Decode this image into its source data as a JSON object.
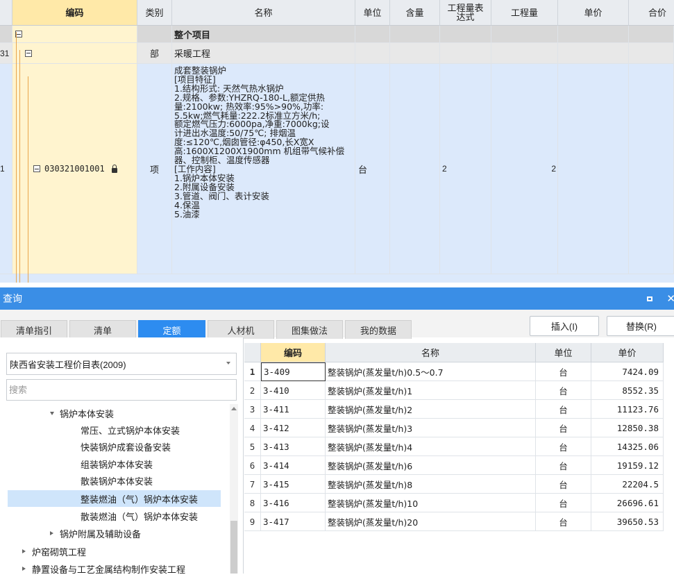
{
  "grid": {
    "headers": {
      "code": "编码",
      "category": "类别",
      "name": "名称",
      "unit": "单位",
      "content": "含量",
      "qty_expr_line1": "工程量表",
      "qty_expr_line2": "达式",
      "quantity": "工程量",
      "unit_price": "单价",
      "total": "合价"
    },
    "rows": {
      "project": {
        "index": "",
        "name": "整个项目"
      },
      "part": {
        "index": "31",
        "category": "部",
        "name": "采暖工程"
      },
      "item": {
        "index": "1",
        "code": "030321001001",
        "category": "项",
        "unit": "台",
        "qty_expr": "2",
        "quantity": "2",
        "desc_lines": [
          "成套整装锅炉",
          "[项目特征]",
          "1.结构形式: 天然气热水锅炉",
          "2.规格、参数:YHZRQ-180-L,额定供热",
          "量:2100kw; 热效率:95%>90%,功率:",
          "5.5kw;燃气耗量:222.2标准立方米/h;",
          "额定燃气压力:6000pa,净重:7000kg;设",
          "计进出水温度:50/75℃; 排烟温",
          "度:≤120℃,烟囱管径:φ450,长X宽X",
          "高:1600X1200X1900mm 机组带气候补偿",
          "器、控制柜、温度传感器",
          "[工作内容]",
          "1.锅炉本体安装",
          "2.附属设备安装",
          "3.管道、阀门、表计安装",
          "4.保温",
          "5.油漆"
        ]
      }
    }
  },
  "query": {
    "title": "查询",
    "tabs": [
      "清单指引",
      "清单",
      "定额",
      "人材机",
      "图集做法",
      "我的数据"
    ],
    "active_tab": "定额",
    "insert_button": "插入(I)",
    "replace_button": "替换(R)",
    "library_select": "陕西省安装工程价目表(2009)",
    "search_placeholder": "搜索",
    "tree": [
      {
        "label": "锅炉本体安装",
        "level": 1,
        "expanded": true
      },
      {
        "label": "常压、立式锅炉本体安装",
        "level": 2
      },
      {
        "label": "快装锅炉成套设备安装",
        "level": 2
      },
      {
        "label": "组装锅炉本体安装",
        "level": 2
      },
      {
        "label": "散装锅炉本体安装",
        "level": 2
      },
      {
        "label": "整装燃油（气）锅炉本体安装",
        "level": 2,
        "selected": true
      },
      {
        "label": "散装燃油（气）锅炉本体安装",
        "level": 2
      },
      {
        "label": "锅炉附属及辅助设备",
        "level": 1,
        "expanded": false
      },
      {
        "label": "炉窑砌筑工程",
        "level": 0,
        "expanded": false
      },
      {
        "label": "静置设备与工艺金属结构制作安装工程",
        "level": 0,
        "expanded": false
      }
    ],
    "table": {
      "headers": {
        "code": "编码",
        "name": "名称",
        "unit": "单位",
        "price": "单价"
      },
      "rows": [
        {
          "idx": "1",
          "code": "3-409",
          "name": "整装锅炉(蒸发量t/h)0.5～0.7",
          "unit": "台",
          "price": "7424.09"
        },
        {
          "idx": "2",
          "code": "3-410",
          "name": "整装锅炉(蒸发量t/h)1",
          "unit": "台",
          "price": "8552.35"
        },
        {
          "idx": "3",
          "code": "3-411",
          "name": "整装锅炉(蒸发量t/h)2",
          "unit": "台",
          "price": "11123.76"
        },
        {
          "idx": "4",
          "code": "3-412",
          "name": "整装锅炉(蒸发量t/h)3",
          "unit": "台",
          "price": "12850.38"
        },
        {
          "idx": "5",
          "code": "3-413",
          "name": "整装锅炉(蒸发量t/h)4",
          "unit": "台",
          "price": "14325.06"
        },
        {
          "idx": "6",
          "code": "3-414",
          "name": "整装锅炉(蒸发量t/h)6",
          "unit": "台",
          "price": "19159.12"
        },
        {
          "idx": "7",
          "code": "3-415",
          "name": "整装锅炉(蒸发量t/h)8",
          "unit": "台",
          "price": "22204.5"
        },
        {
          "idx": "8",
          "code": "3-416",
          "name": "整装锅炉(蒸发量t/h)10",
          "unit": "台",
          "price": "26696.61"
        },
        {
          "idx": "9",
          "code": "3-417",
          "name": "整装锅炉(蒸发量t/h)20",
          "unit": "台",
          "price": "39650.53"
        }
      ]
    }
  },
  "colors": {
    "accent": "#3a8ee6",
    "selected_header": "#ffe9a8",
    "row_blue": "#dce9fb",
    "tree_selected": "#cfe5fb"
  }
}
